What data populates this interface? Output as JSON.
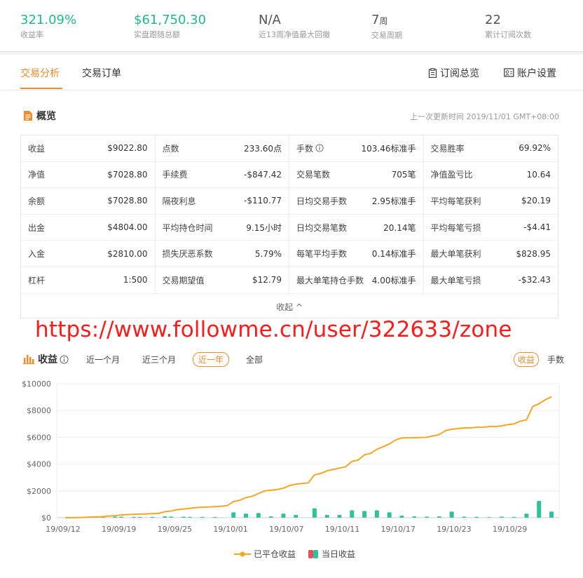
{
  "stats": [
    {
      "value": "321.09%",
      "unit": "",
      "label": "收益率",
      "teal": true
    },
    {
      "value": "$61,750.30",
      "unit": "",
      "label": "实盘跟随总额",
      "teal": true
    },
    {
      "value": "N/A",
      "unit": "",
      "label": "近13周净值最大回撤",
      "teal": false
    },
    {
      "value": "7",
      "unit": "周",
      "label": "交易周期",
      "teal": false
    },
    {
      "value": "22",
      "unit": "",
      "label": "累计订阅次数",
      "teal": false
    }
  ],
  "tabs": {
    "analysis": "交易分析",
    "orders": "交易订单",
    "subscription": "订阅总览",
    "account": "账户设置"
  },
  "overview": {
    "title": "概览",
    "updated": "上一次更新时间 2019/11/01 GMT+08:00",
    "collapse": "收起 ^"
  },
  "table": [
    [
      [
        "收益",
        "$9022.80"
      ],
      [
        "点数",
        "233.60点"
      ],
      [
        "手数",
        "103.46标准手"
      ],
      [
        "交易胜率",
        "69.92%"
      ]
    ],
    [
      [
        "净值",
        "$7028.80"
      ],
      [
        "手续费",
        "-$847.42"
      ],
      [
        "交易笔数",
        "705笔"
      ],
      [
        "净值盈亏比",
        "10.64"
      ]
    ],
    [
      [
        "余额",
        "$7028.80"
      ],
      [
        "隔夜利息",
        "-$110.77"
      ],
      [
        "日均交易手数",
        "2.95标准手"
      ],
      [
        "平均每笔获利",
        "$20.19"
      ]
    ],
    [
      [
        "出金",
        "$4804.00"
      ],
      [
        "平均持仓时间",
        "9.15小时"
      ],
      [
        "日均交易笔数",
        "20.14笔"
      ],
      [
        "平均每笔亏损",
        "-$4.41"
      ]
    ],
    [
      [
        "入金",
        "$2810.00"
      ],
      [
        "损失厌恶系数",
        "5.79%"
      ],
      [
        "每笔平均手数",
        "0.14标准手"
      ],
      [
        "最大单笔获利",
        "$828.95"
      ]
    ],
    [
      [
        "杠杆",
        "1:500"
      ],
      [
        "交易期望值",
        "$12.79"
      ],
      [
        "最大单笔持仓手数",
        "4.00标准手"
      ],
      [
        "最大单笔亏损",
        "-$32.43"
      ]
    ]
  ],
  "watermark": "https://www.followme.cn/user/322633/zone",
  "profit": {
    "title": "收益",
    "ranges": [
      "近一个月",
      "近三个月",
      "近一年",
      "全部"
    ],
    "active_range": 2,
    "toggle_profit": "收益",
    "toggle_lots": "手数",
    "legend_line": "已平仓收益",
    "legend_bar": "当日收益"
  },
  "colors": {
    "accent": "#f08c2c",
    "teal": "#1fb98c",
    "line": "#f5a623",
    "bar": "#2ec29a"
  },
  "chart_data": {
    "type": "line",
    "x_ticks": [
      "19/09/12",
      "19/09/19",
      "19/09/25",
      "19/10/01",
      "19/10/07",
      "19/10/11",
      "19/10/17",
      "19/10/23",
      "19/10/29"
    ],
    "y_ticks": [
      "$0",
      "$2000",
      "$4000",
      "$6000",
      "$8000",
      "$10000"
    ],
    "ylim": [
      0,
      10000
    ],
    "series": [
      {
        "name": "已平仓收益",
        "type": "line",
        "values": [
          0,
          0,
          10,
          20,
          50,
          60,
          80,
          120,
          150,
          200,
          230,
          250,
          270,
          280,
          300,
          320,
          450,
          500,
          600,
          650,
          700,
          750,
          780,
          800,
          820,
          850,
          900,
          1200,
          1300,
          1500,
          1600,
          1800,
          2000,
          2050,
          2100,
          2200,
          2400,
          2500,
          2550,
          2600,
          3200,
          3300,
          3500,
          3600,
          3700,
          3800,
          4200,
          4300,
          4700,
          4800,
          5100,
          5300,
          5500,
          5800,
          5950,
          5960,
          5970,
          5980,
          6000,
          6100,
          6200,
          6500,
          6600,
          6650,
          6700,
          6700,
          6750,
          6750,
          6800,
          6800,
          6850,
          6950,
          7000,
          7200,
          7300,
          8300,
          8500,
          8800,
          9022.8
        ]
      },
      {
        "name": "当日收益",
        "type": "bar",
        "values": [
          0,
          0,
          40,
          0,
          60,
          40,
          50,
          0,
          80,
          70,
          0,
          60,
          50,
          0,
          60,
          0,
          100,
          80,
          0,
          70,
          60,
          0,
          60,
          0,
          50,
          0,
          0,
          400,
          0,
          300,
          0,
          350,
          0,
          100,
          0,
          300,
          0,
          200,
          0,
          0,
          700,
          0,
          200,
          0,
          200,
          0,
          550,
          0,
          500,
          0,
          550,
          0,
          400,
          0,
          150,
          0,
          100,
          0,
          80,
          0,
          100,
          0,
          450,
          0,
          80,
          0,
          60,
          0,
          40,
          0,
          80,
          0,
          60,
          0,
          300,
          0,
          1250,
          0,
          450
        ]
      }
    ]
  }
}
